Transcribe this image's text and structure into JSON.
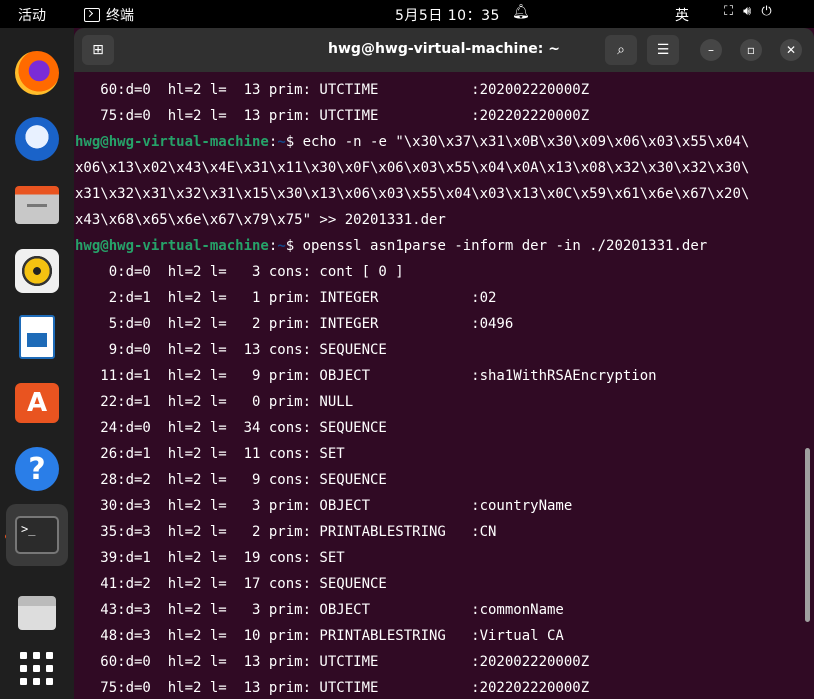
{
  "topbar": {
    "activities": "活动",
    "app_name": "终端",
    "clock": "5月5日  10：35",
    "ime": "英",
    "icons": [
      "network-icon",
      "volume-icon",
      "power-icon"
    ]
  },
  "dock": {
    "apps": [
      "Firefox",
      "Thunderbird",
      "Files",
      "Rhythmbox",
      "LibreOffice Writer",
      "Ubuntu Software",
      "Help",
      "Terminal",
      "Trash",
      "Show Applications"
    ],
    "active": "Terminal",
    "accent": "#e95420"
  },
  "window": {
    "title": "hwg@hwg-virtual-machine: ~",
    "new_tab_icon": "new-tab-icon",
    "search_icon": "search-icon",
    "menu_icon": "hamburger-menu-icon"
  },
  "terminal": {
    "colors": {
      "bg": "#300a24",
      "user": "#26a269",
      "path": "#12488b",
      "text": "#ffffff"
    },
    "prompt_user": "hwg@hwg-virtual-machine",
    "prompt_sep": ":",
    "prompt_path": "~",
    "prompt_end": "$ ",
    "lines": [
      {
        "text": "   60:d=0  hl=2 l=  13 prim: UTCTIME           :202002220000Z"
      },
      {
        "text": "   75:d=0  hl=2 l=  13 prim: UTCTIME           :202202220000Z"
      },
      {
        "prompt": true,
        "cmd": "echo -n -e \"\\x30\\x37\\x31\\x0B\\x30\\x09\\x06\\x03\\x55\\x04\\"
      },
      {
        "text": "x06\\x13\\x02\\x43\\x4E\\x31\\x11\\x30\\x0F\\x06\\x03\\x55\\x04\\x0A\\x13\\x08\\x32\\x30\\x32\\x30\\"
      },
      {
        "text": "x31\\x32\\x31\\x32\\x31\\x15\\x30\\x13\\x06\\x03\\x55\\x04\\x03\\x13\\x0C\\x59\\x61\\x6e\\x67\\x20\\"
      },
      {
        "text": "x43\\x68\\x65\\x6e\\x67\\x79\\x75\" >> 20201331.der"
      },
      {
        "prompt": true,
        "cmd": "openssl asn1parse -inform der -in ./20201331.der"
      },
      {
        "text": "    0:d=0  hl=2 l=   3 cons: cont [ 0 ]"
      },
      {
        "text": "    2:d=1  hl=2 l=   1 prim: INTEGER           :02"
      },
      {
        "text": "    5:d=0  hl=2 l=   2 prim: INTEGER           :0496"
      },
      {
        "text": "    9:d=0  hl=2 l=  13 cons: SEQUENCE"
      },
      {
        "text": "   11:d=1  hl=2 l=   9 prim: OBJECT            :sha1WithRSAEncryption"
      },
      {
        "text": "   22:d=1  hl=2 l=   0 prim: NULL"
      },
      {
        "text": "   24:d=0  hl=2 l=  34 cons: SEQUENCE"
      },
      {
        "text": "   26:d=1  hl=2 l=  11 cons: SET"
      },
      {
        "text": "   28:d=2  hl=2 l=   9 cons: SEQUENCE"
      },
      {
        "text": "   30:d=3  hl=2 l=   3 prim: OBJECT            :countryName"
      },
      {
        "text": "   35:d=3  hl=2 l=   2 prim: PRINTABLESTRING   :CN"
      },
      {
        "text": "   39:d=1  hl=2 l=  19 cons: SET"
      },
      {
        "text": "   41:d=2  hl=2 l=  17 cons: SEQUENCE"
      },
      {
        "text": "   43:d=3  hl=2 l=   3 prim: OBJECT            :commonName"
      },
      {
        "text": "   48:d=3  hl=2 l=  10 prim: PRINTABLESTRING   :Virtual CA"
      },
      {
        "text": "   60:d=0  hl=2 l=  13 prim: UTCTIME           :202002220000Z"
      },
      {
        "text": "   75:d=0  hl=2 l=  13 prim: UTCTIME           :202202220000Z"
      }
    ]
  }
}
